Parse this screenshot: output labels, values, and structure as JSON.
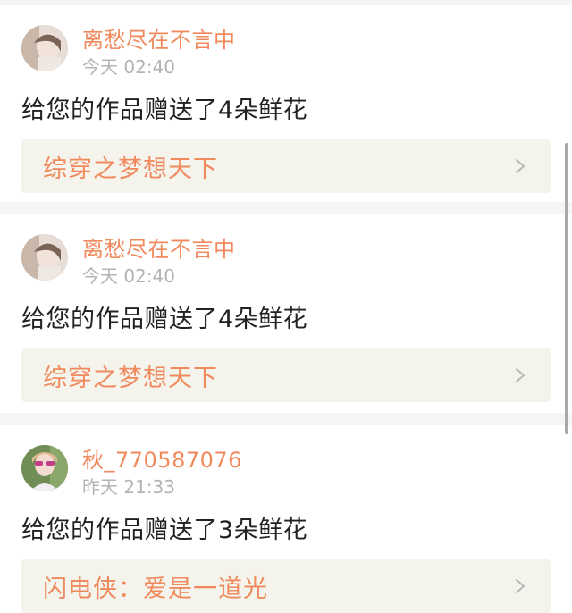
{
  "feed": {
    "items": [
      {
        "username": "离愁尽在不言中",
        "time": "今天 02:40",
        "message": "给您的作品赠送了4朵鲜花",
        "work_title": "综穿之梦想天下",
        "avatar_icon": "user-avatar-icon"
      },
      {
        "username": "离愁尽在不言中",
        "time": "今天 02:40",
        "message": "给您的作品赠送了4朵鲜花",
        "work_title": "综穿之梦想天下",
        "avatar_icon": "user-avatar-icon"
      },
      {
        "username": "秋_770587076",
        "time": "昨天 21:33",
        "message": "给您的作品赠送了3朵鲜花",
        "work_title": "闪电侠：爱是一道光",
        "avatar_icon": "user-avatar-icon"
      }
    ]
  },
  "colors": {
    "accent": "#f08a5d",
    "muted_text": "#b4b4b4",
    "body_text": "#222222",
    "link_bg": "#f4f3ec",
    "page_bg": "#f5f5f5"
  }
}
